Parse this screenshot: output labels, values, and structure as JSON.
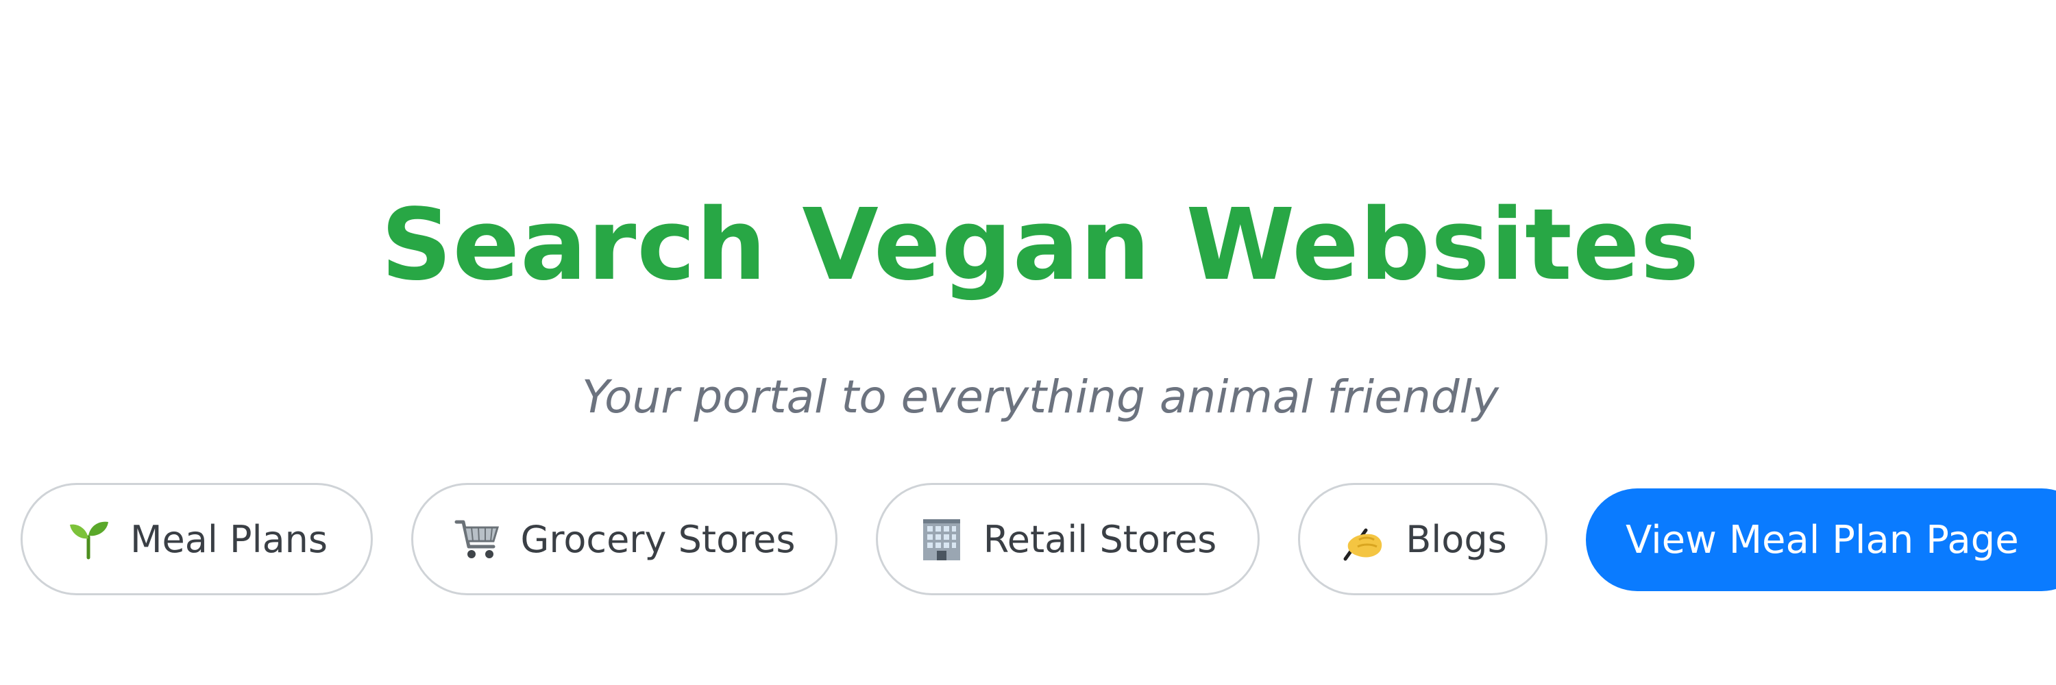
{
  "header": {
    "title": "Search Vegan Websites",
    "subtitle": "Your portal to everything animal friendly"
  },
  "nav": {
    "chips": [
      {
        "label": "Meal Plans",
        "icon": "seedling-icon"
      },
      {
        "label": "Grocery Stores",
        "icon": "shopping-cart-icon"
      },
      {
        "label": "Retail Stores",
        "icon": "office-building-icon"
      },
      {
        "label": "Blogs",
        "icon": "writing-hand-icon"
      }
    ],
    "cta_label": "View Meal Plan Page"
  },
  "colors": {
    "title": "#28a745",
    "subtitle": "#6c737f",
    "chip_border": "#cfd3d7",
    "cta_background": "#0a7bff"
  }
}
